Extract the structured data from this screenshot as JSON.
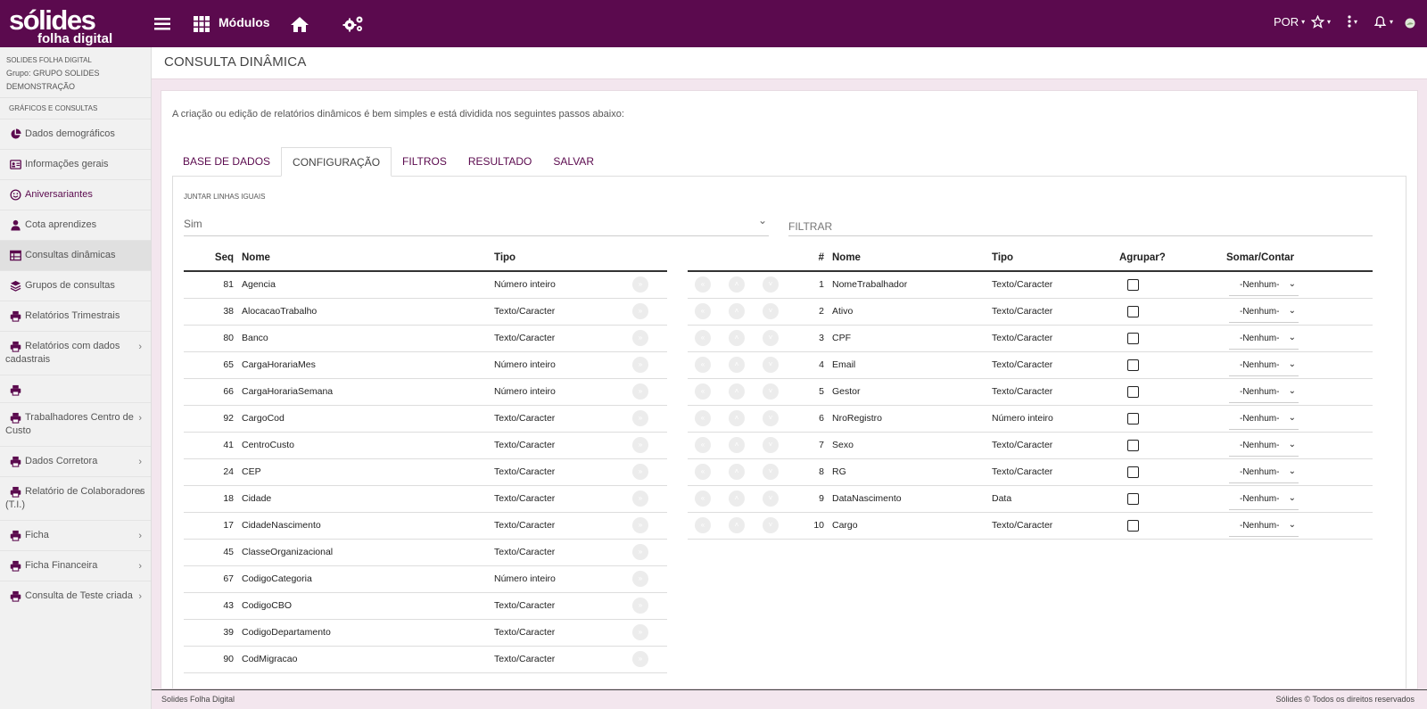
{
  "brand": {
    "line1": "sólides",
    "line2": "folha digital"
  },
  "topbar": {
    "modulos_label": "Módulos",
    "language": "POR"
  },
  "sidebar": {
    "org_title": "SOLIDES FOLHA DIGITAL",
    "org_group": "Grupo: GRUPO SOLIDES",
    "org_demo": "DEMONSTRAÇÃO",
    "section": "GRÁFICOS E CONSULTAS",
    "items": [
      {
        "label": "Dados demográficos",
        "icon": "pie-chart-icon"
      },
      {
        "label": "Informações gerais",
        "icon": "id-card-icon"
      },
      {
        "label": "Aniversariantes",
        "icon": "smile-icon"
      },
      {
        "label": "Cota aprendizes",
        "icon": "user-tie-icon"
      },
      {
        "label": "Consultas dinâmicas",
        "icon": "table-icon"
      },
      {
        "label": "Grupos de consultas",
        "icon": "layers-icon"
      },
      {
        "label": "Relatórios Trimestrais",
        "icon": "print-icon"
      },
      {
        "label": "Relatórios com dados cadastrais",
        "icon": "print-icon"
      },
      {
        "label": "",
        "icon": "print-icon"
      },
      {
        "label": "Trabalhadores Centro de Custo",
        "icon": "print-icon"
      },
      {
        "label": "Dados Corretora",
        "icon": "print-icon"
      },
      {
        "label": "Relatório de Colaboradores (T.I.)",
        "icon": "print-icon"
      },
      {
        "label": "Ficha",
        "icon": "print-icon"
      },
      {
        "label": "Ficha Financeira",
        "icon": "print-icon"
      },
      {
        "label": "Consulta de Teste criada",
        "icon": "print-icon"
      }
    ]
  },
  "page": {
    "title": "CONSULTA DINÂMICA",
    "intro": "A criação ou edição de relatórios dinâmicos é bem simples e está dividida nos seguintes passos abaixo:"
  },
  "tabs": [
    "BASE DE DADOS",
    "CONFIGURAÇÃO",
    "FILTROS",
    "RESULTADO",
    "SALVAR"
  ],
  "config": {
    "juntar_label": "JUNTAR LINHAS IGUAIS",
    "juntar_value": "Sim",
    "filter_placeholder": "FILTRAR"
  },
  "left_table": {
    "headers": {
      "seq": "Seq",
      "nome": "Nome",
      "tipo": "Tipo"
    },
    "rows": [
      {
        "seq": "81",
        "nome": "Agencia",
        "tipo": "Número inteiro"
      },
      {
        "seq": "38",
        "nome": "AlocacaoTrabalho",
        "tipo": "Texto/Caracter"
      },
      {
        "seq": "80",
        "nome": "Banco",
        "tipo": "Texto/Caracter"
      },
      {
        "seq": "65",
        "nome": "CargaHorariaMes",
        "tipo": "Número inteiro"
      },
      {
        "seq": "66",
        "nome": "CargaHorariaSemana",
        "tipo": "Número inteiro"
      },
      {
        "seq": "92",
        "nome": "CargoCod",
        "tipo": "Texto/Caracter"
      },
      {
        "seq": "41",
        "nome": "CentroCusto",
        "tipo": "Texto/Caracter"
      },
      {
        "seq": "24",
        "nome": "CEP",
        "tipo": "Texto/Caracter"
      },
      {
        "seq": "18",
        "nome": "Cidade",
        "tipo": "Texto/Caracter"
      },
      {
        "seq": "17",
        "nome": "CidadeNascimento",
        "tipo": "Texto/Caracter"
      },
      {
        "seq": "45",
        "nome": "ClasseOrganizacional",
        "tipo": "Texto/Caracter"
      },
      {
        "seq": "67",
        "nome": "CodigoCategoria",
        "tipo": "Número inteiro"
      },
      {
        "seq": "43",
        "nome": "CodigoCBO",
        "tipo": "Texto/Caracter"
      },
      {
        "seq": "39",
        "nome": "CodigoDepartamento",
        "tipo": "Texto/Caracter"
      },
      {
        "seq": "90",
        "nome": "CodMigracao",
        "tipo": "Texto/Caracter"
      }
    ]
  },
  "right_table": {
    "headers": {
      "num": "#",
      "nome": "Nome",
      "tipo": "Tipo",
      "agrupar": "Agrupar?",
      "somar": "Somar/Contar"
    },
    "rows": [
      {
        "num": "1",
        "nome": "NomeTrabalhador",
        "tipo": "Texto/Caracter",
        "somar": "-Nenhum-"
      },
      {
        "num": "2",
        "nome": "Ativo",
        "tipo": "Texto/Caracter",
        "somar": "-Nenhum-"
      },
      {
        "num": "3",
        "nome": "CPF",
        "tipo": "Texto/Caracter",
        "somar": "-Nenhum-"
      },
      {
        "num": "4",
        "nome": "Email",
        "tipo": "Texto/Caracter",
        "somar": "-Nenhum-"
      },
      {
        "num": "5",
        "nome": "Gestor",
        "tipo": "Texto/Caracter",
        "somar": "-Nenhum-"
      },
      {
        "num": "6",
        "nome": "NroRegistro",
        "tipo": "Número inteiro",
        "somar": "-Nenhum-"
      },
      {
        "num": "7",
        "nome": "Sexo",
        "tipo": "Texto/Caracter",
        "somar": "-Nenhum-"
      },
      {
        "num": "8",
        "nome": "RG",
        "tipo": "Texto/Caracter",
        "somar": "-Nenhum-"
      },
      {
        "num": "9",
        "nome": "DataNascimento",
        "tipo": "Data",
        "somar": "-Nenhum-"
      },
      {
        "num": "10",
        "nome": "Cargo",
        "tipo": "Texto/Caracter",
        "somar": "-Nenhum-"
      }
    ]
  },
  "footer": {
    "left": "Solides Folha Digital",
    "right": "Sólides © Todos os direitos reservados"
  },
  "colors": {
    "brand": "#5b0a4e",
    "background": "#f3e6ee"
  }
}
